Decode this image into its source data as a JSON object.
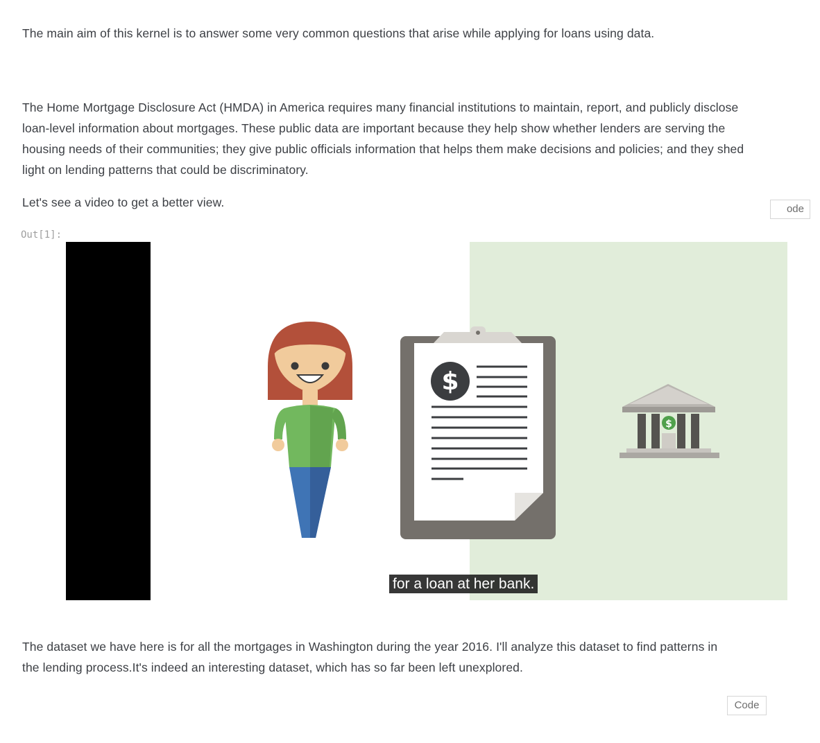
{
  "paragraphs": {
    "aim": "The main aim of this kernel is to answer some very common questions that arise while applying for loans using data.",
    "hmda": "The Home Mortgage Disclosure Act (HMDA) in America requires many financial institutions to maintain, report, and publicly disclose loan-level information about mortgages. These public data are important because they help show whether lenders are serving the housing needs of their communities; they give public officials information that helps them make decisions and policies; and they shed light on lending patterns that could be discriminatory.",
    "video_intro": "Let's see a video to get a better view.",
    "dataset": "The dataset we have here is for all the mortgages in Washington during the year 2016. I'll analyze this dataset to find patterns in the lending process.It's indeed an interesting dataset, which has so far been left unexplored."
  },
  "buttons": {
    "code_top": "ode",
    "code_bottom": "Code"
  },
  "output": {
    "prompt": "Out[1]:"
  },
  "video": {
    "caption": "for a loan at her bank.",
    "icons": [
      "person-illustration",
      "clipboard-document-icon",
      "bank-building-icon"
    ],
    "colors": {
      "panel_green": "#e1edda",
      "hair": "#b3503a",
      "shirt": "#72b85e",
      "pants": "#3f74b5",
      "clipboard": "#74706b"
    }
  }
}
